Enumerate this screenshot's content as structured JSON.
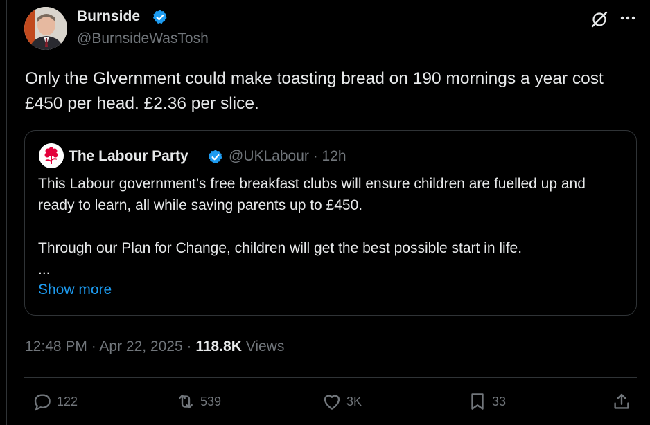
{
  "author": {
    "name": "Burnside",
    "handle": "@BurnsideWasTosh"
  },
  "tweet": {
    "text": "Only the Glvernment could make toasting bread on 190 mornings a year cost £450 per head. £2.36 per slice."
  },
  "quote": {
    "name": "The Labour Party",
    "handle_time": "@UKLabour · 12h",
    "text": "This Labour government’s free breakfast clubs will ensure children are fuelled up and ready to learn, all while saving parents up to £450.\n\nThrough our Plan for Change, children will get the best possible start in life.\n...",
    "show_more": "Show more"
  },
  "meta": {
    "time_date": "12:48 PM · Apr 22, 2025 · ",
    "views_count": "118.8K",
    "views_label": " Views"
  },
  "actions": {
    "replies": "122",
    "reposts": "539",
    "likes": "3K",
    "bookmarks": "33"
  },
  "colors": {
    "background": "#000000",
    "text": "#e7e9ea",
    "muted": "#71767b",
    "accent": "#1d9bf0",
    "labour_red": "#e4003b"
  },
  "icons": [
    "verified-badge-icon",
    "grok-icon",
    "more-icon",
    "reply-icon",
    "repost-icon",
    "like-icon",
    "bookmark-icon",
    "share-icon"
  ]
}
